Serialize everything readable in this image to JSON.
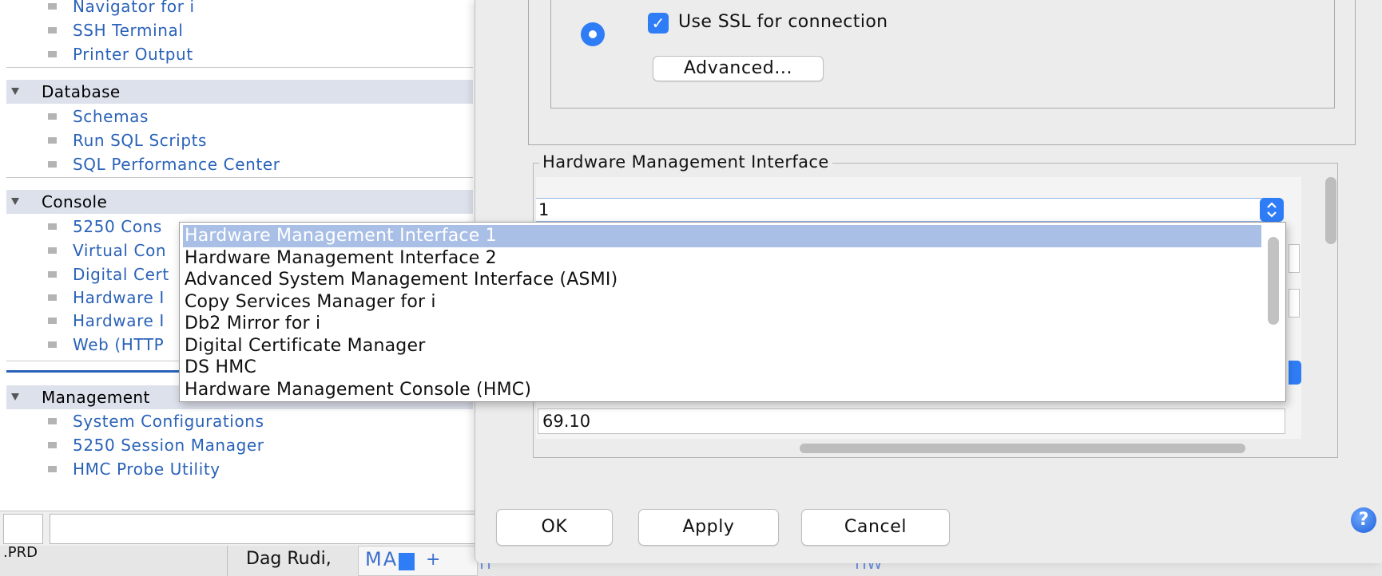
{
  "nav": {
    "items_top": [
      "Navigator for i",
      "SSH Terminal",
      "Printer Output"
    ],
    "sections": [
      {
        "title": "Database",
        "items": [
          "Schemas",
          "Run SQL Scripts",
          "SQL Performance Center"
        ]
      },
      {
        "title": "Console",
        "items": [
          "5250 Cons",
          "Virtual Con",
          "Digital Cert",
          "Hardware I",
          "Hardware I",
          "Web (HTTP"
        ]
      },
      {
        "title": "Management",
        "items": [
          "System Configurations",
          "5250 Session Manager",
          "HMC Probe Utility"
        ]
      }
    ]
  },
  "taskbar": {
    "left_label": ".PRD",
    "user_label": "Dag Rudi,",
    "tab_label": "MA",
    "plus_label": "+",
    "partial_1": "H",
    "partial_2": "HW"
  },
  "dialog": {
    "ssl_label": "Use SSL for connection",
    "ssl_checked": true,
    "advanced_button": "Advanced...",
    "hmi_legend": "Hardware Management Interface",
    "hmi_select_value": "1",
    "ip_value": "69.10",
    "ok_button": "OK",
    "apply_button": "Apply",
    "cancel_button": "Cancel",
    "help_icon": "question-mark-icon"
  },
  "dropdown": {
    "options": [
      "Hardware Management Interface 1",
      "Hardware Management Interface 2",
      "Advanced System Management Interface (ASMI)",
      "Copy Services Manager for i",
      "Db2 Mirror for i",
      "Digital Certificate Manager",
      "DS HMC",
      "Hardware Management Console (HMC)"
    ],
    "selected_index": 0
  },
  "colors": {
    "accent": "#2f7df6",
    "nav_link": "#2a62b8",
    "section_bg": "#dde1ec",
    "selection": "#a9bfe6"
  }
}
